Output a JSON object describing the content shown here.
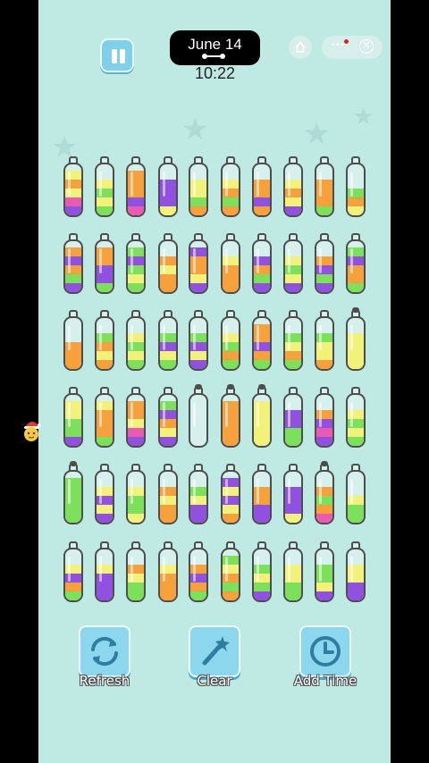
{
  "status": {
    "date": "June 14",
    "time": "10:22"
  },
  "palette": {
    "Y": "#f2f27a",
    "O": "#f7a13c",
    "G": "#7de05a",
    "P": "#9050e0",
    "K": "#ea5ab2",
    "E": ""
  },
  "bottles": [
    [
      "PKYOY",
      "GYGY",
      "KPOOO",
      "YPPP",
      "OGYY",
      "OGOY",
      "OPOO",
      "PYOY",
      "GOOO",
      "YOG"
    ],
    [
      "PGOPO",
      "GPPOO",
      "GYGPG",
      "OOYO",
      "PYOOP",
      "OOOY",
      "PGOP",
      "PYGY",
      "PGPO",
      "GOOPG"
    ],
    [
      "OOO",
      "OYOG",
      "GYGY",
      "GYPG",
      "PYPG",
      "GOGY",
      "GOPOO",
      "GOYG",
      "OYYG",
      "YYYY"
    ],
    [
      "PGGYY",
      "GOOOY",
      "PKYOO",
      "PYOPG",
      "EE",
      "OOOOO",
      "YYYYY",
      "GGPP",
      "PKPO",
      "GYGY"
    ],
    [
      "GGGGG",
      "PYPY",
      "YGGY",
      "OOYO",
      "PPYG",
      "OYPYP",
      "PPOO",
      "YPPP",
      "KOGO",
      "GGY"
    ],
    [
      "GOPY",
      "PPPY",
      "GGYO",
      "OOOY",
      "GOPO",
      "OGOYG",
      "PGYG",
      "GGYY",
      "PYGG",
      "PPYY"
    ]
  ],
  "capped": [
    [],
    [],
    [
      9
    ],
    [
      4,
      5,
      6
    ],
    [
      0,
      8
    ],
    []
  ],
  "toolbar": {
    "refresh_label": "Refresh",
    "clear_label": "Clear",
    "add_time_label": "Add Time"
  },
  "icons": {
    "pause": "pause-icon",
    "home": "home-icon",
    "more": "more-icon",
    "close": "close-icon",
    "refresh": "refresh-icon",
    "clear": "magic-wand-icon",
    "add_time": "clock-icon",
    "mascot": "santa-mascot-icon"
  }
}
